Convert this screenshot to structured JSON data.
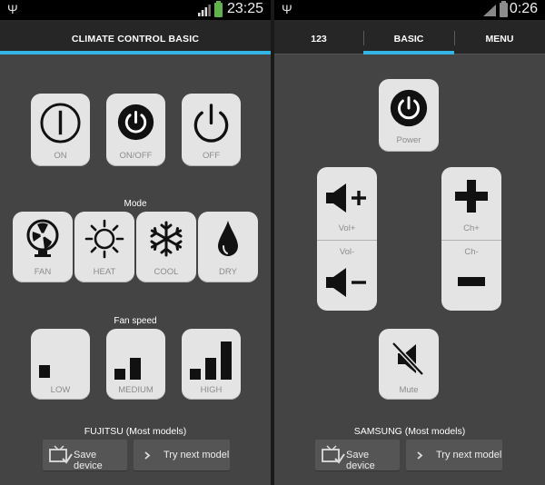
{
  "screens": {
    "left": {
      "status": {
        "time": "23:25"
      },
      "title": "CLIMATE CONTROL BASIC",
      "power_buttons": [
        {
          "label": "ON"
        },
        {
          "label": "ON/OFF"
        },
        {
          "label": "OFF"
        }
      ],
      "mode": {
        "heading": "Mode",
        "buttons": [
          {
            "label": "FAN"
          },
          {
            "label": "HEAT"
          },
          {
            "label": "COOL"
          },
          {
            "label": "DRY"
          }
        ]
      },
      "fan_speed": {
        "heading": "Fan speed",
        "buttons": [
          {
            "label": "LOW"
          },
          {
            "label": "MEDIUM"
          },
          {
            "label": "HIGH"
          }
        ]
      },
      "device_name": "FUJITSU (Most models)",
      "save_label": "Save device",
      "next_label": "Try next model"
    },
    "right": {
      "status": {
        "time": "0:26"
      },
      "tabs": [
        "123",
        "BASIC",
        "MENU"
      ],
      "power_label": "Power",
      "vol_plus_label": "Vol+",
      "vol_minus_label": "Vol-",
      "ch_plus_label": "Ch+",
      "ch_minus_label": "Ch-",
      "mute_label": "Mute",
      "device_name": "SAMSUNG (Most models)",
      "save_label": "Save device",
      "next_label": "Try next model"
    }
  },
  "colors": {
    "accent": "#33b5e5",
    "panel_bg": "#444444",
    "button_bg": "#e4e4e4",
    "battery_left": "#5fb34a",
    "battery_right": "#8c8c8c"
  }
}
